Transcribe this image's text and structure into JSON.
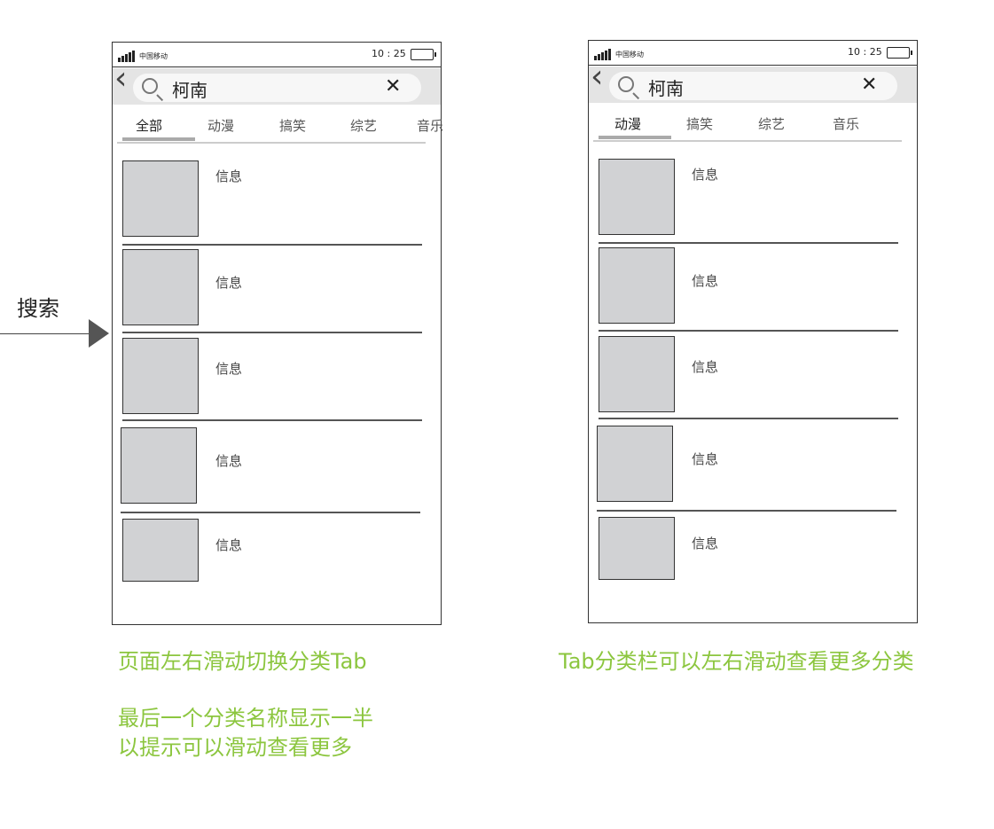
{
  "arrow": {
    "label": "搜索"
  },
  "phones": [
    {
      "carrier": "中国移动",
      "time": "10 : 25",
      "query": "柯南",
      "tabs": [
        "全部",
        "动漫",
        "搞笑",
        "综艺",
        "音乐"
      ],
      "active": 0,
      "items": [
        "信息",
        "信息",
        "信息",
        "信息",
        "信息"
      ]
    },
    {
      "carrier": "中国移动",
      "time": "10 : 25",
      "query": "柯南",
      "tabs": [
        "动漫",
        "搞笑",
        "综艺",
        "音乐"
      ],
      "active": 0,
      "items": [
        "信息",
        "信息",
        "信息",
        "信息",
        "信息"
      ]
    }
  ],
  "notes": {
    "left_1": "页面左右滑动切换分类Tab",
    "left_2": "最后一个分类名称显示一半",
    "left_3": "以提示可以滑动查看更多",
    "right_1": "Tab分类栏可以左右滑动查看更多分类"
  },
  "colors": {
    "note": "#8cc63f",
    "thumb": "#d1d2d4"
  }
}
